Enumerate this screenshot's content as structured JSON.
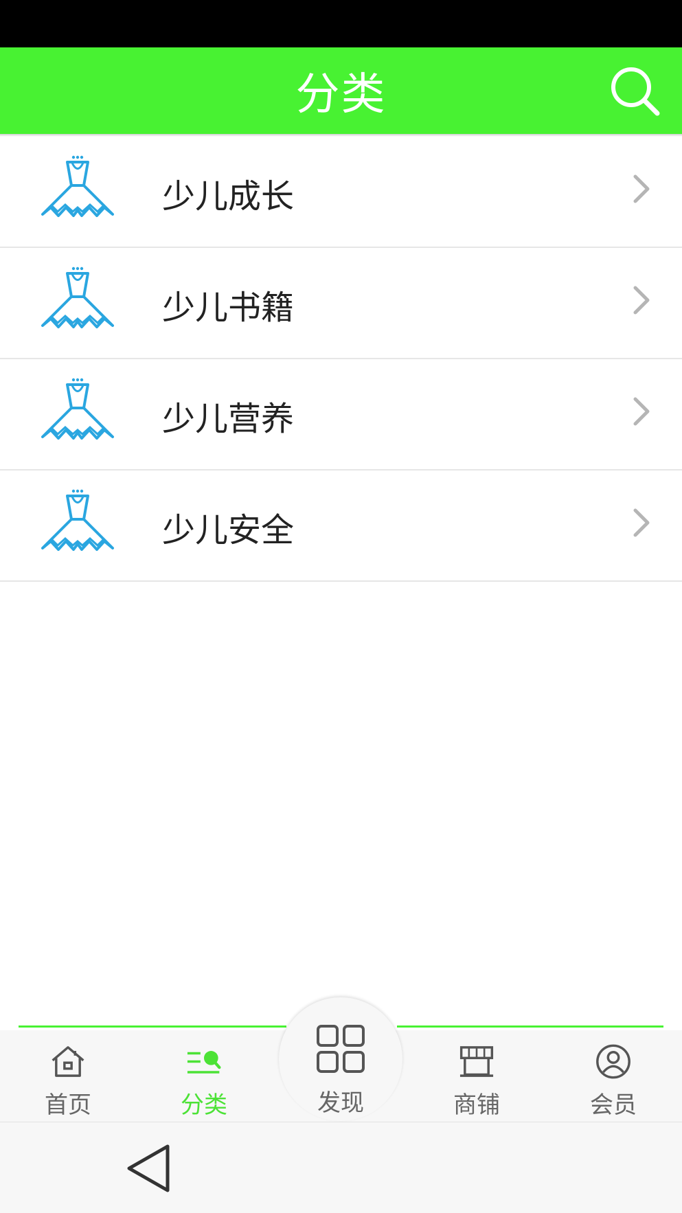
{
  "header": {
    "title": "分类",
    "search_icon": "search-icon"
  },
  "categories": [
    {
      "label": "少儿成长",
      "icon": "dress-icon"
    },
    {
      "label": "少儿书籍",
      "icon": "dress-icon"
    },
    {
      "label": "少儿营养",
      "icon": "dress-icon"
    },
    {
      "label": "少儿安全",
      "icon": "dress-icon"
    }
  ],
  "tabs": [
    {
      "label": "首页",
      "icon": "home-icon",
      "active": false
    },
    {
      "label": "分类",
      "icon": "category-icon",
      "active": true
    },
    {
      "label": "发现",
      "icon": "grid-icon",
      "active": false
    },
    {
      "label": "商铺",
      "icon": "store-icon",
      "active": false
    },
    {
      "label": "会员",
      "icon": "user-icon",
      "active": false
    }
  ],
  "colors": {
    "header": "#48f232",
    "active_tab": "#4ce236",
    "icon_blue": "#2aa6e0",
    "inactive_tab": "#666666"
  }
}
